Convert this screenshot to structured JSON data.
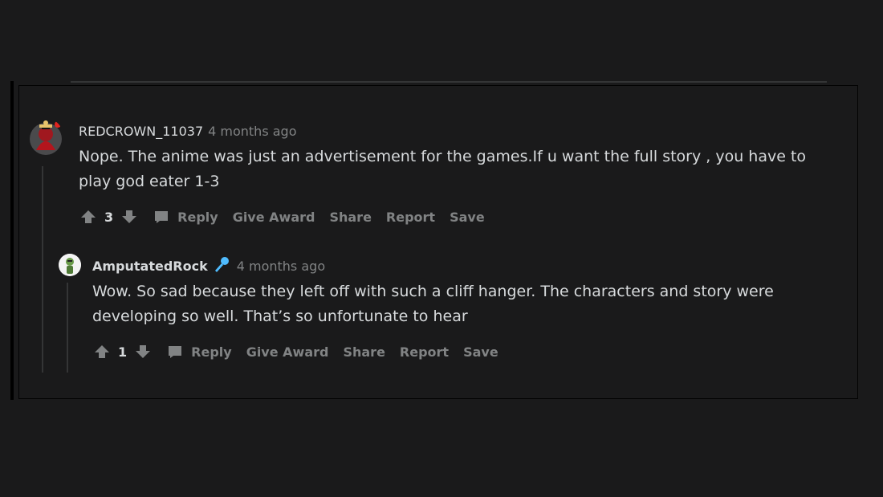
{
  "comments": [
    {
      "author": "REDCROWN_11037",
      "time": "4 months ago",
      "body": "Nope. The anime was just an advertisement for the games.If u want the full story , you have to\nplay god eater 1-3",
      "votes": "3",
      "actions": {
        "reply": "Reply",
        "award": "Give Award",
        "share": "Share",
        "report": "Report",
        "save": "Save"
      }
    },
    {
      "author": "AmputatedRock",
      "time": "4 months ago",
      "body": "Wow. So sad because they left off with such a cliff hanger. The characters and story were\ndeveloping so well. That’s so unfortunate to hear",
      "votes": "1",
      "actions": {
        "reply": "Reply",
        "award": "Give Award",
        "share": "Share",
        "report": "Report",
        "save": "Save"
      }
    }
  ],
  "colors": {
    "background": "#1a1a1b",
    "text": "#d7dadc",
    "muted": "#818384",
    "thread_line": "#343536",
    "flair_blue": "#4fbcff"
  },
  "icons": [
    "upvote-icon",
    "downvote-icon",
    "comment-icon",
    "microphone-flair-icon"
  ]
}
